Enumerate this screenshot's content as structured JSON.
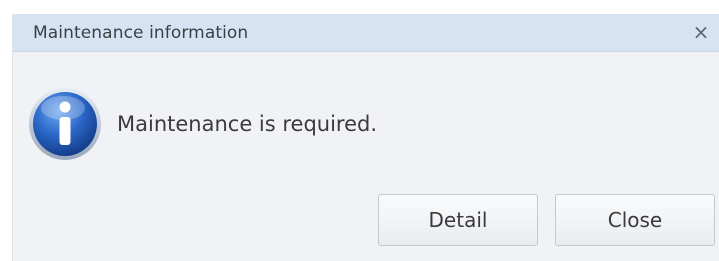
{
  "dialog": {
    "title": "Maintenance information",
    "close_glyph": "×",
    "icon": "info-icon",
    "message": "Maintenance is required."
  },
  "buttons": {
    "detail_label": "Detail",
    "close_label": "Close"
  },
  "colors": {
    "titlebar": "#d6e3f2",
    "body": "#f0f2f5",
    "icon_blue": "#1f5bb8"
  }
}
